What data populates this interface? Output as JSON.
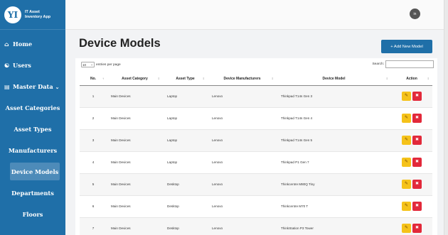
{
  "app": {
    "name_line1": "IT Asset",
    "name_line2": "Inventory App",
    "logo_text": "YI"
  },
  "sidebar": {
    "home": "Home",
    "users": "Users",
    "master_data": "Master Data",
    "sub_items": [
      "Asset Categories",
      "Asset Types",
      "Manufacturers",
      "Device Models",
      "Departments",
      "Floors"
    ],
    "active": "Device Models"
  },
  "topbar": {
    "avatar_initials": "in"
  },
  "page": {
    "title": "Device Models",
    "add_button": "+ Add New Model",
    "length_value": "10",
    "length_label": "entries per page",
    "search_label": "Search:"
  },
  "table": {
    "headers": [
      "No.",
      "Asset Category",
      "Asset Type",
      "Device Manufacturers",
      "Device Model",
      "Action"
    ],
    "rows": [
      [
        "1",
        "Main Devices",
        "Laptop",
        "Lenovo",
        "Thinkpad T14s Gen 3"
      ],
      [
        "2",
        "Main Devices",
        "Laptop",
        "Lenovo",
        "Thinkpad T14s Gen 4"
      ],
      [
        "3",
        "Main Devices",
        "Laptop",
        "Lenovo",
        "Thinkpad T14s Gen 5"
      ],
      [
        "4",
        "Main Devices",
        "Laptop",
        "Lenovo",
        "Thinkpad P1 Gen 7"
      ],
      [
        "5",
        "Main Devices",
        "Desktop",
        "Lenovo",
        "Thinkcentre M80Q Tiny"
      ],
      [
        "6",
        "Main Devices",
        "Desktop",
        "Lenovo",
        "Thinkcentre M70 T"
      ],
      [
        "7",
        "Main Devices",
        "Desktop",
        "Lenovo",
        "ThinkStation P3 Tower"
      ]
    ]
  },
  "colors": {
    "sidebar": "#1f6fa8",
    "primary_button": "#1f6fa8",
    "edit_button": "#f5c21a",
    "delete_button": "#e2293a"
  }
}
